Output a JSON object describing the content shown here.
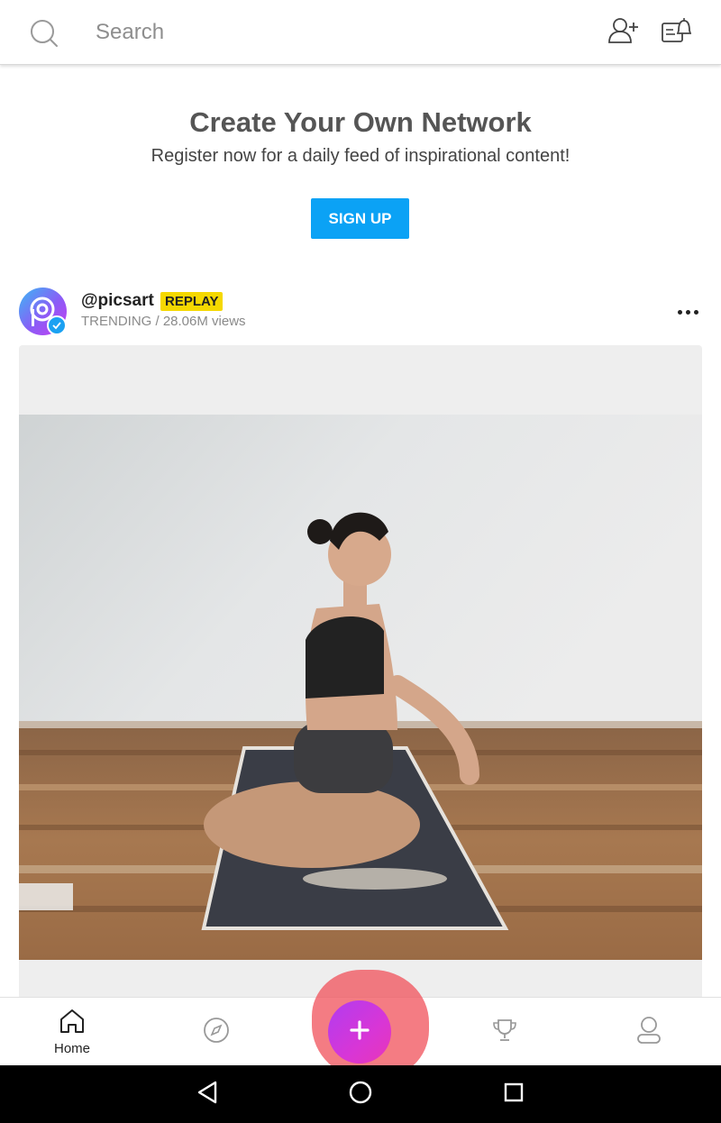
{
  "search": {
    "placeholder": "Search"
  },
  "promo": {
    "title": "Create Your Own Network",
    "subtitle": "Register now for a daily feed of inspirational content!",
    "signup_label": "SIGN UP"
  },
  "post": {
    "username": "@picsart",
    "badge": "REPLAY",
    "meta": "TRENDING / 28.06M views"
  },
  "bottom_nav": {
    "home_label": "Home",
    "items": [
      "home-icon",
      "compass-icon",
      "add-icon",
      "trophy-icon",
      "profile-icon"
    ]
  },
  "colors": {
    "accent": "#0ba2f5",
    "badge": "#f5d800",
    "fab_start": "#b13cf0",
    "fab_end": "#e836b8",
    "highlight": "#f0505a"
  }
}
